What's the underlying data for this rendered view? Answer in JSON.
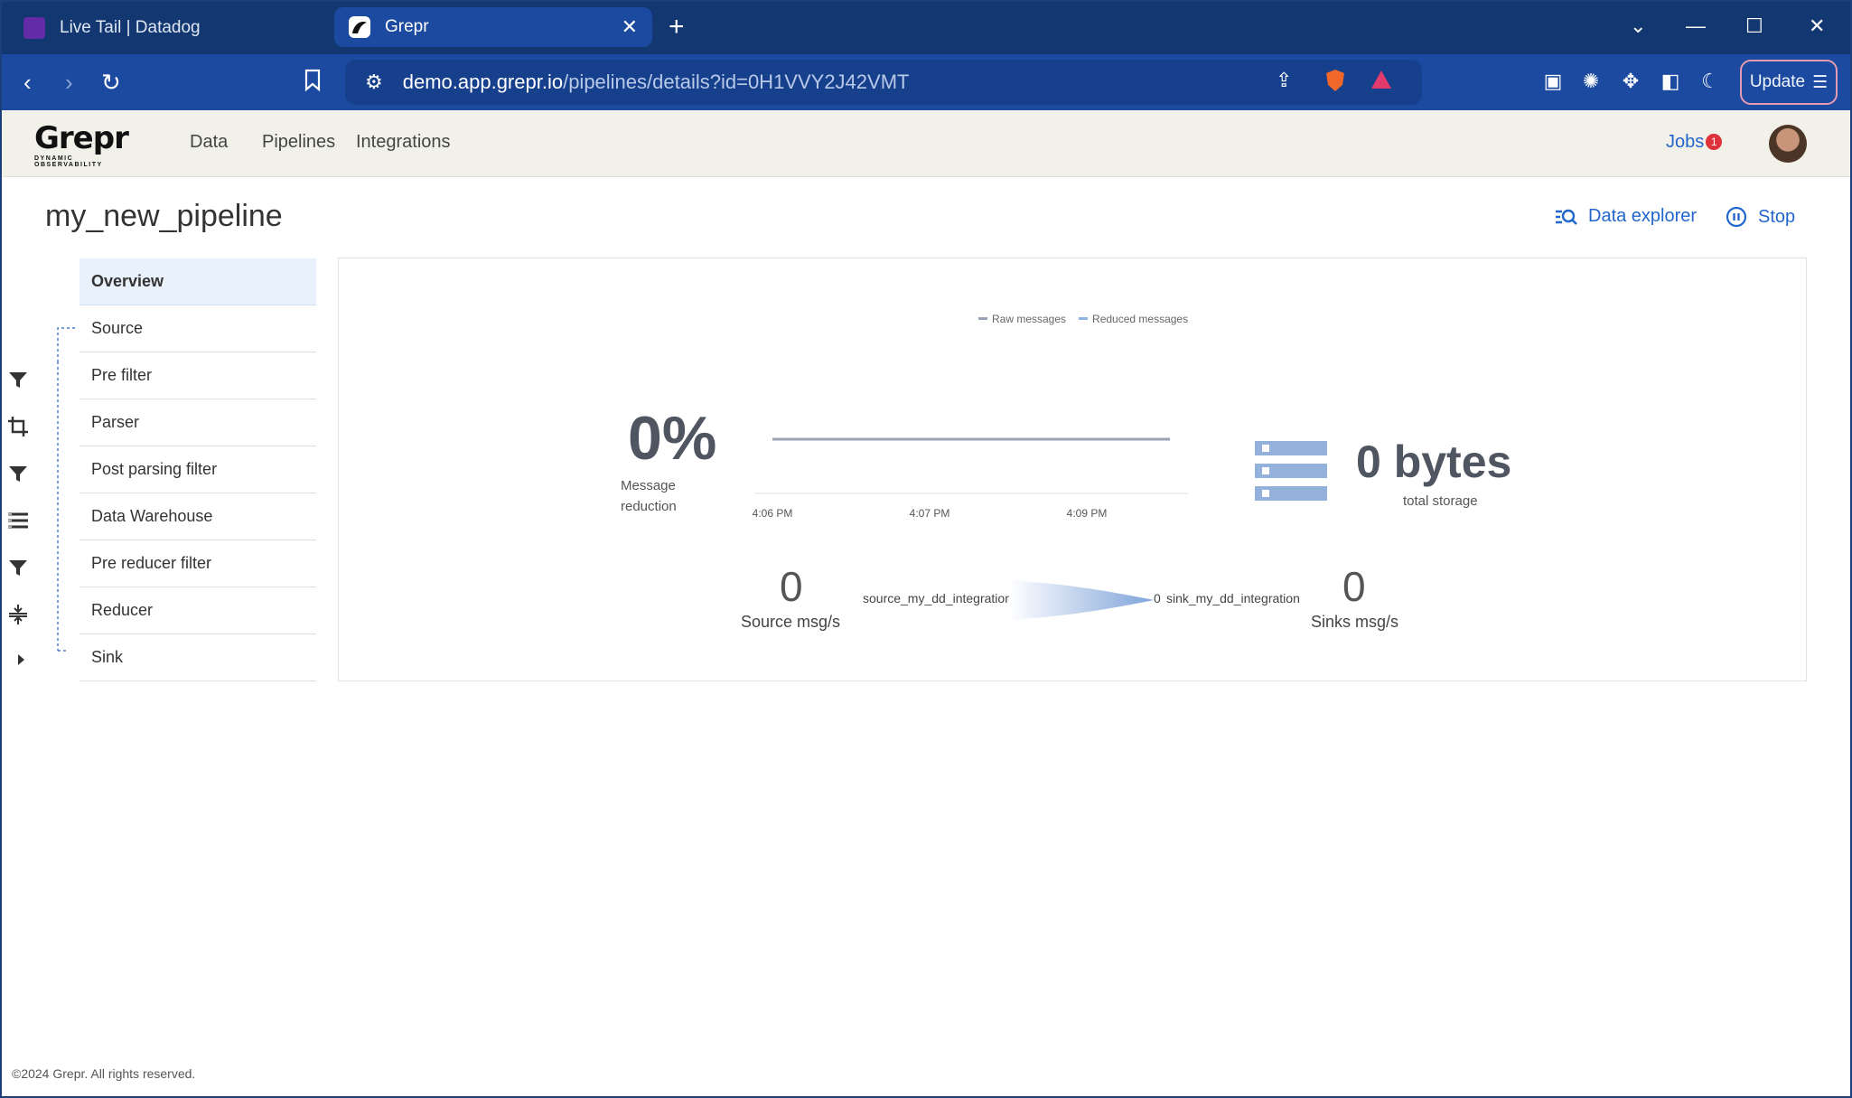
{
  "browser": {
    "tabs": [
      {
        "title": "Live Tail | Datadog",
        "active": false,
        "icon": "datadog-icon"
      },
      {
        "title": "Grepr",
        "active": true,
        "icon": "grepr-icon"
      }
    ],
    "address": {
      "host": "demo.app.grepr.io",
      "path": "/pipelines/details?id=0H1VVY2J42VMT"
    },
    "update_label": "Update",
    "colors": {
      "frame": "#133770",
      "toolbar": "#1b4aa0"
    }
  },
  "app": {
    "logo_text": "Grepr",
    "logo_tagline": "DYNAMIC OBSERVABILITY",
    "nav": [
      "Data",
      "Pipelines",
      "Integrations"
    ],
    "jobs_label": "Jobs",
    "jobs_count": "1"
  },
  "page": {
    "title": "my_new_pipeline",
    "actions": {
      "explorer": "Data explorer",
      "stop": "Stop"
    },
    "steps": [
      "Overview",
      "Source",
      "Pre filter",
      "Parser",
      "Post parsing filter",
      "Data Warehouse",
      "Pre reducer filter",
      "Reducer",
      "Sink"
    ],
    "step_icons": [
      "funnel-icon",
      "crop-icon",
      "funnel-icon",
      "list-icon",
      "funnel-icon",
      "compress-icon",
      "arrow-right-icon"
    ]
  },
  "overview": {
    "reduction_value": "0%",
    "reduction_label": "Message reduction",
    "storage_value": "0 bytes",
    "storage_label": "total storage",
    "source_rate": "0",
    "source_rate_label": "Source msg/s",
    "source_name": "source_my_dd_integration",
    "sink_prefix": "0",
    "sink_name": "sink_my_dd_integration",
    "sink_rate": "0",
    "sink_rate_label": "Sinks msg/s"
  },
  "chart_data": {
    "type": "line",
    "x": [
      "4:06 PM",
      "4:07 PM",
      "4:09 PM"
    ],
    "series": [
      {
        "name": "Raw messages",
        "values": [
          0,
          0,
          0
        ],
        "color": "#9aa3b5"
      },
      {
        "name": "Reduced messages",
        "values": [
          0,
          0,
          0
        ],
        "color": "#8fb3e3"
      }
    ],
    "legend": "top-center",
    "grid": false
  },
  "footer": "©2024 Grepr. All rights reserved."
}
